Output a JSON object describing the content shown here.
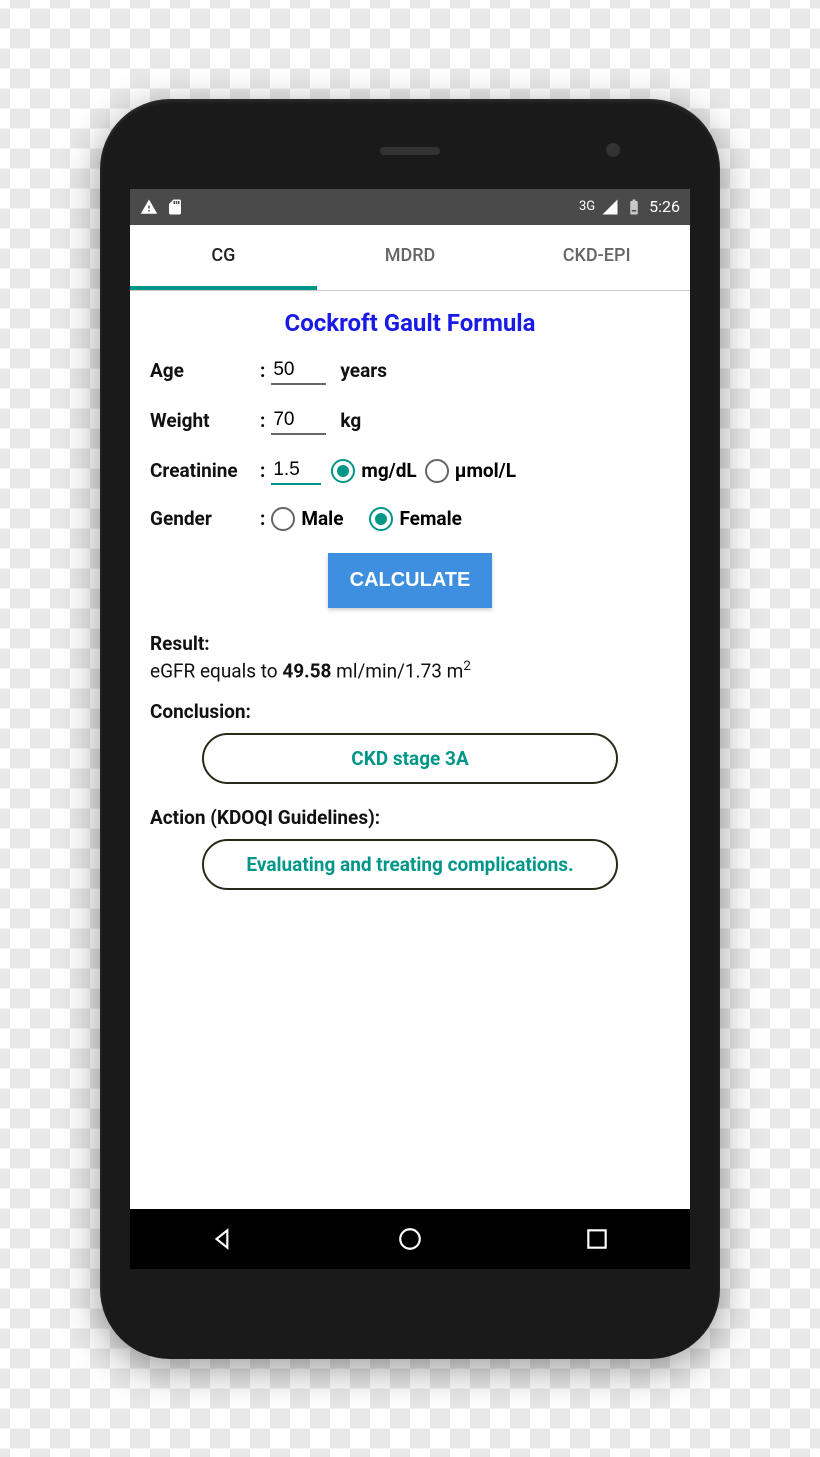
{
  "statusBar": {
    "networkLabel": "3G",
    "time": "5:26"
  },
  "tabs": [
    {
      "label": "CG",
      "active": true
    },
    {
      "label": "MDRD",
      "active": false
    },
    {
      "label": "CKD-EPI",
      "active": false
    }
  ],
  "title": "Cockroft Gault Formula",
  "form": {
    "age": {
      "label": "Age",
      "value": "50",
      "unit": "years"
    },
    "weight": {
      "label": "Weight",
      "value": "70",
      "unit": "kg"
    },
    "creatinine": {
      "label": "Creatinine",
      "value": "1.5",
      "units": [
        {
          "label": "mg/dL",
          "checked": true
        },
        {
          "label": "µmol/L",
          "checked": false
        }
      ]
    },
    "gender": {
      "label": "Gender",
      "options": [
        {
          "label": "Male",
          "checked": false
        },
        {
          "label": "Female",
          "checked": true
        }
      ]
    }
  },
  "calculateLabel": "CALCULATE",
  "result": {
    "heading": "Result:",
    "prefix": "eGFR equals to ",
    "value": "49.58",
    "unit": " ml/min/1.73 m",
    "exponent": "2"
  },
  "conclusion": {
    "heading": "Conclusion:",
    "text": "CKD stage 3A"
  },
  "action": {
    "heading": "Action (KDOQI Guidelines):",
    "text": "Evaluating and treating complications."
  }
}
